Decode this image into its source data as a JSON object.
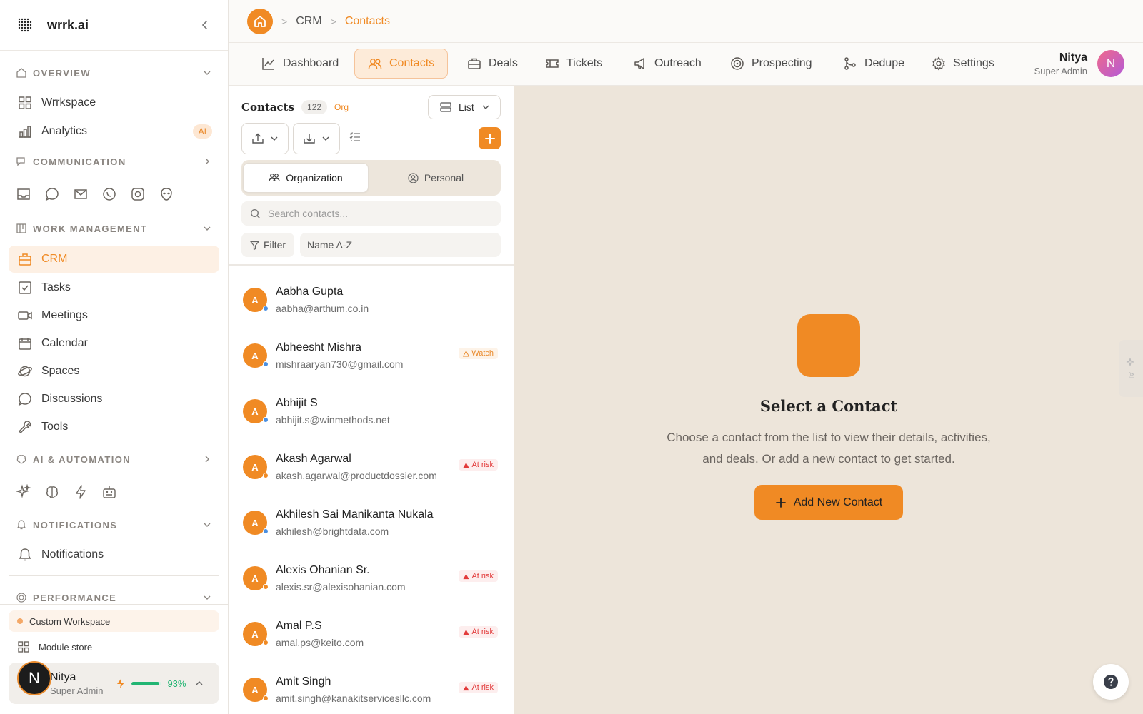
{
  "brand": {
    "name": "wrrk.ai"
  },
  "sidebar": {
    "sections": {
      "overview": "OVERVIEW",
      "communication": "COMMUNICATION",
      "work_management": "WORK MANAGEMENT",
      "ai_automation": "AI & AUTOMATION",
      "notifications": "NOTIFICATIONS",
      "performance": "PERFORMANCE"
    },
    "overview_items": [
      {
        "label": "Wrrkspace",
        "icon": "grid-icon"
      },
      {
        "label": "Analytics",
        "icon": "bar-chart-icon",
        "badge": "AI"
      }
    ],
    "communication_icons": [
      "inbox-icon",
      "chat-bubble-icon",
      "mail-icon",
      "whatsapp-icon",
      "instagram-icon",
      "alien-icon"
    ],
    "work_items": [
      {
        "label": "CRM",
        "icon": "briefcase-icon",
        "active": true
      },
      {
        "label": "Tasks",
        "icon": "checkbox-icon"
      },
      {
        "label": "Meetings",
        "icon": "video-icon"
      },
      {
        "label": "Calendar",
        "icon": "calendar-icon"
      },
      {
        "label": "Spaces",
        "icon": "planet-icon"
      },
      {
        "label": "Discussions",
        "icon": "message-circle-icon"
      },
      {
        "label": "Tools",
        "icon": "wrench-icon"
      }
    ],
    "ai_icons": [
      "sparkles-icon",
      "brain-icon",
      "zap-icon",
      "robot-icon"
    ],
    "notifications_item": {
      "label": "Notifications",
      "icon": "bell-icon"
    },
    "custom_workspace": "Custom Workspace",
    "module_store": "Module store",
    "user": {
      "name": "Nitya",
      "role": "Super Admin",
      "avatar_letter": "N",
      "progress_percent": 93,
      "progress_label": "93%"
    }
  },
  "breadcrumb": [
    "CRM",
    "Contacts"
  ],
  "tabs": [
    {
      "label": "Dashboard",
      "icon": "line-chart-icon"
    },
    {
      "label": "Contacts",
      "icon": "users-icon",
      "active": true
    },
    {
      "label": "Deals",
      "icon": "briefcase-icon"
    },
    {
      "label": "Tickets",
      "icon": "ticket-icon"
    },
    {
      "label": "Outreach",
      "icon": "megaphone-icon"
    },
    {
      "label": "Prospecting",
      "icon": "target-icon"
    },
    {
      "label": "Dedupe",
      "icon": "git-merge-icon"
    },
    {
      "label": "Settings",
      "icon": "gear-icon"
    }
  ],
  "top_user": {
    "name": "Nitya",
    "role": "Super Admin",
    "avatar_letter": "N"
  },
  "contacts_panel": {
    "title": "Contacts",
    "count": "122",
    "scope": "Org",
    "view_label": "List",
    "segments": {
      "organization": "Organization",
      "personal": "Personal"
    },
    "search_placeholder": "Search contacts...",
    "filter_label": "Filter",
    "sort_label": "Name A-Z"
  },
  "contacts": [
    {
      "initial": "A",
      "name": "Aabha Gupta",
      "email": "aabha@arthum.co.in",
      "status": "blue",
      "badge": ""
    },
    {
      "initial": "A",
      "name": "Abheesht Mishra",
      "email": "mishraaryan730@gmail.com",
      "status": "blue",
      "badge": "Watch"
    },
    {
      "initial": "A",
      "name": "Abhijit S",
      "email": "abhijit.s@winmethods.net",
      "status": "blue",
      "badge": ""
    },
    {
      "initial": "A",
      "name": "Akash Agarwal",
      "email": "akash.agarwal@productdossier.com",
      "status": "orange",
      "badge": "At risk"
    },
    {
      "initial": "A",
      "name": "Akhilesh Sai Manikanta Nukala",
      "email": "akhilesh@brightdata.com",
      "status": "blue",
      "badge": ""
    },
    {
      "initial": "A",
      "name": "Alexis Ohanian Sr.",
      "email": "alexis.sr@alexisohanian.com",
      "status": "orange",
      "badge": "At risk"
    },
    {
      "initial": "A",
      "name": "Amal P.S",
      "email": "amal.ps@keito.com",
      "status": "orange",
      "badge": "At risk"
    },
    {
      "initial": "A",
      "name": "Amit Singh",
      "email": "amit.singh@kanakitservicesllc.com",
      "status": "orange",
      "badge": "At risk"
    }
  ],
  "empty_state": {
    "title": "Select a Contact",
    "description": "Choose a contact from the list to view their details, activities, and deals. Or add a new contact to get started.",
    "button_label": "Add New Contact"
  },
  "side_tab": {
    "label": "AI"
  },
  "help_label": "?",
  "colors": {
    "accent": "#f08a24",
    "status_blue": "#4a90e2",
    "status_orange": "#f08a24",
    "success": "#22b573",
    "danger": "#e23b3b"
  }
}
